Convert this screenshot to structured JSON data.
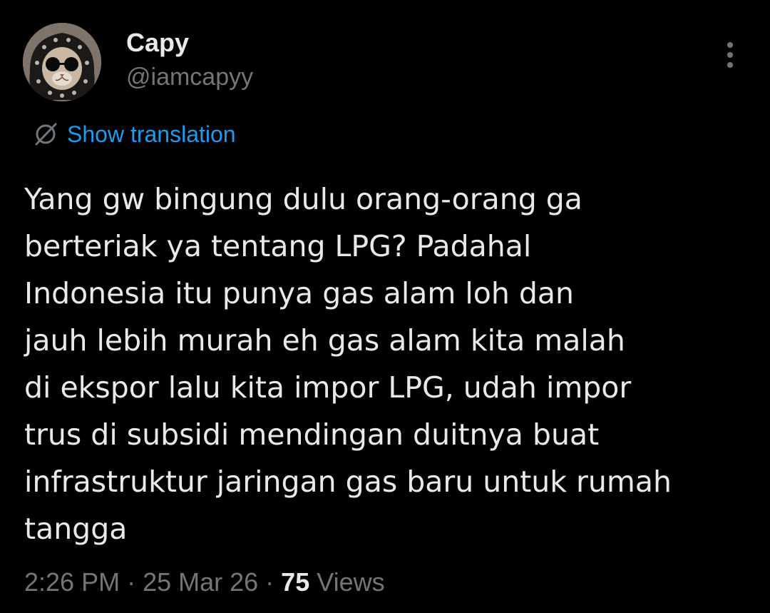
{
  "author": {
    "display_name": "Capy",
    "handle": "@iamcapyy"
  },
  "translation": {
    "label": "Show translation"
  },
  "tweet": {
    "text": "Yang gw bingung dulu orang-orang ga\nberteriak ya tentang LPG? Padahal\nIndonesia itu punya gas alam loh dan\njauh lebih murah eh gas alam kita malah\ndi ekspor lalu kita impor LPG, udah impor\ntrus di subsidi mendingan duitnya buat\ninfrastruktur jaringan gas baru untuk rumah\ntangga"
  },
  "meta": {
    "time": "2:26 PM",
    "separator": "·",
    "date": "25 Mar 26",
    "views_count": "75",
    "views_label": "Views"
  },
  "icons": {
    "more": "more-options-icon",
    "translate": "globe-slash-icon"
  },
  "colors": {
    "background": "#000000",
    "primary_text": "#e7e9ea",
    "secondary_text": "#71767b",
    "link": "#1d9bf0"
  }
}
